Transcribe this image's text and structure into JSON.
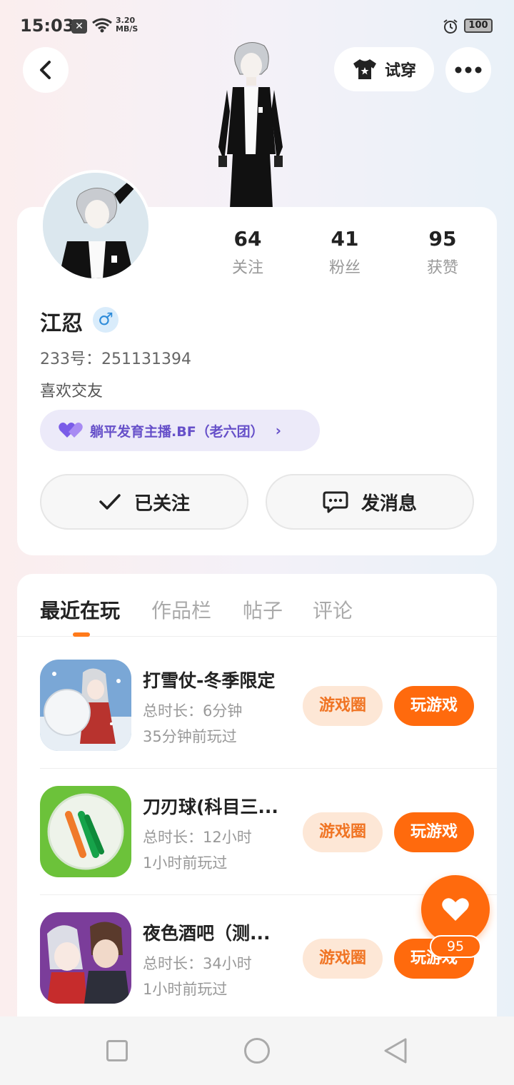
{
  "status_bar": {
    "time": "15:03",
    "net_speed_value": "3.20",
    "net_speed_unit": "MB/S",
    "battery": "100"
  },
  "header": {
    "try_on_label": "试穿"
  },
  "profile": {
    "stats": [
      {
        "value": "64",
        "label": "关注"
      },
      {
        "value": "41",
        "label": "粉丝"
      },
      {
        "value": "95",
        "label": "获赞"
      }
    ],
    "name": "江忍",
    "gender_symbol": "♂",
    "uid": "233号：251131394",
    "bio": "喜欢交友",
    "fan_group": "躺平发育主播.BF（老六团）",
    "follow_label": "已关注",
    "message_label": "发消息"
  },
  "tabs": [
    {
      "label": "最近在玩"
    },
    {
      "label": "作品栏"
    },
    {
      "label": "帖子"
    },
    {
      "label": "评论"
    }
  ],
  "games": [
    {
      "title": "打雪仗-冬季限定",
      "duration": "总时长：6分钟",
      "last_played": "35分钟前玩过",
      "circle_label": "游戏圈",
      "play_label": "玩游戏"
    },
    {
      "title": "刀刃球(科目三...",
      "duration": "总时长：12小时",
      "last_played": "1小时前玩过",
      "circle_label": "游戏圈",
      "play_label": "玩游戏"
    },
    {
      "title": "夜色酒吧（测...",
      "duration": "总时长：34小时",
      "last_played": "1小时前玩过",
      "circle_label": "游戏圈",
      "play_label": "玩游戏"
    }
  ],
  "like_fab": {
    "count": "95"
  },
  "colors": {
    "accent": "#ff6a0d",
    "accent_soft": "#fde7d6",
    "fan_tag_bg": "#eceaf9",
    "fan_tag_text": "#6650c9"
  }
}
